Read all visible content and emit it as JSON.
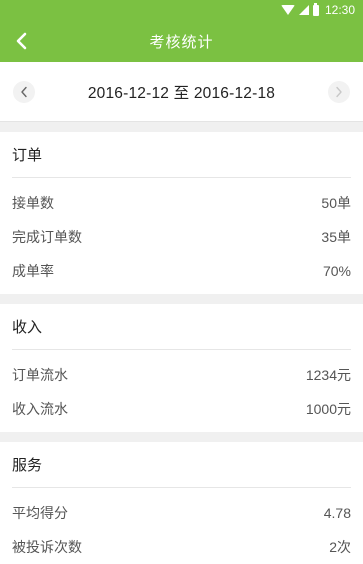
{
  "status_bar": {
    "time": "12:30"
  },
  "header": {
    "title": "考核统计"
  },
  "date_bar": {
    "range": "2016-12-12 至 2016-12-18"
  },
  "sections": [
    {
      "title": "订单",
      "rows": [
        {
          "label": "接单数",
          "value": "50单"
        },
        {
          "label": "完成订单数",
          "value": "35单"
        },
        {
          "label": "成单率",
          "value": "70%"
        }
      ]
    },
    {
      "title": "收入",
      "rows": [
        {
          "label": "订单流水",
          "value": "1234元"
        },
        {
          "label": "收入流水",
          "value": "1000元"
        }
      ]
    },
    {
      "title": "服务",
      "rows": [
        {
          "label": "平均得分",
          "value": "4.78"
        },
        {
          "label": "被投诉次数",
          "value": "2次"
        }
      ]
    }
  ],
  "colors": {
    "accent": "#7bc142",
    "background": "#f0f0f0"
  },
  "icons": {
    "back": "chevron-left-icon",
    "prev": "chevron-left-icon",
    "next": "chevron-right-icon"
  }
}
